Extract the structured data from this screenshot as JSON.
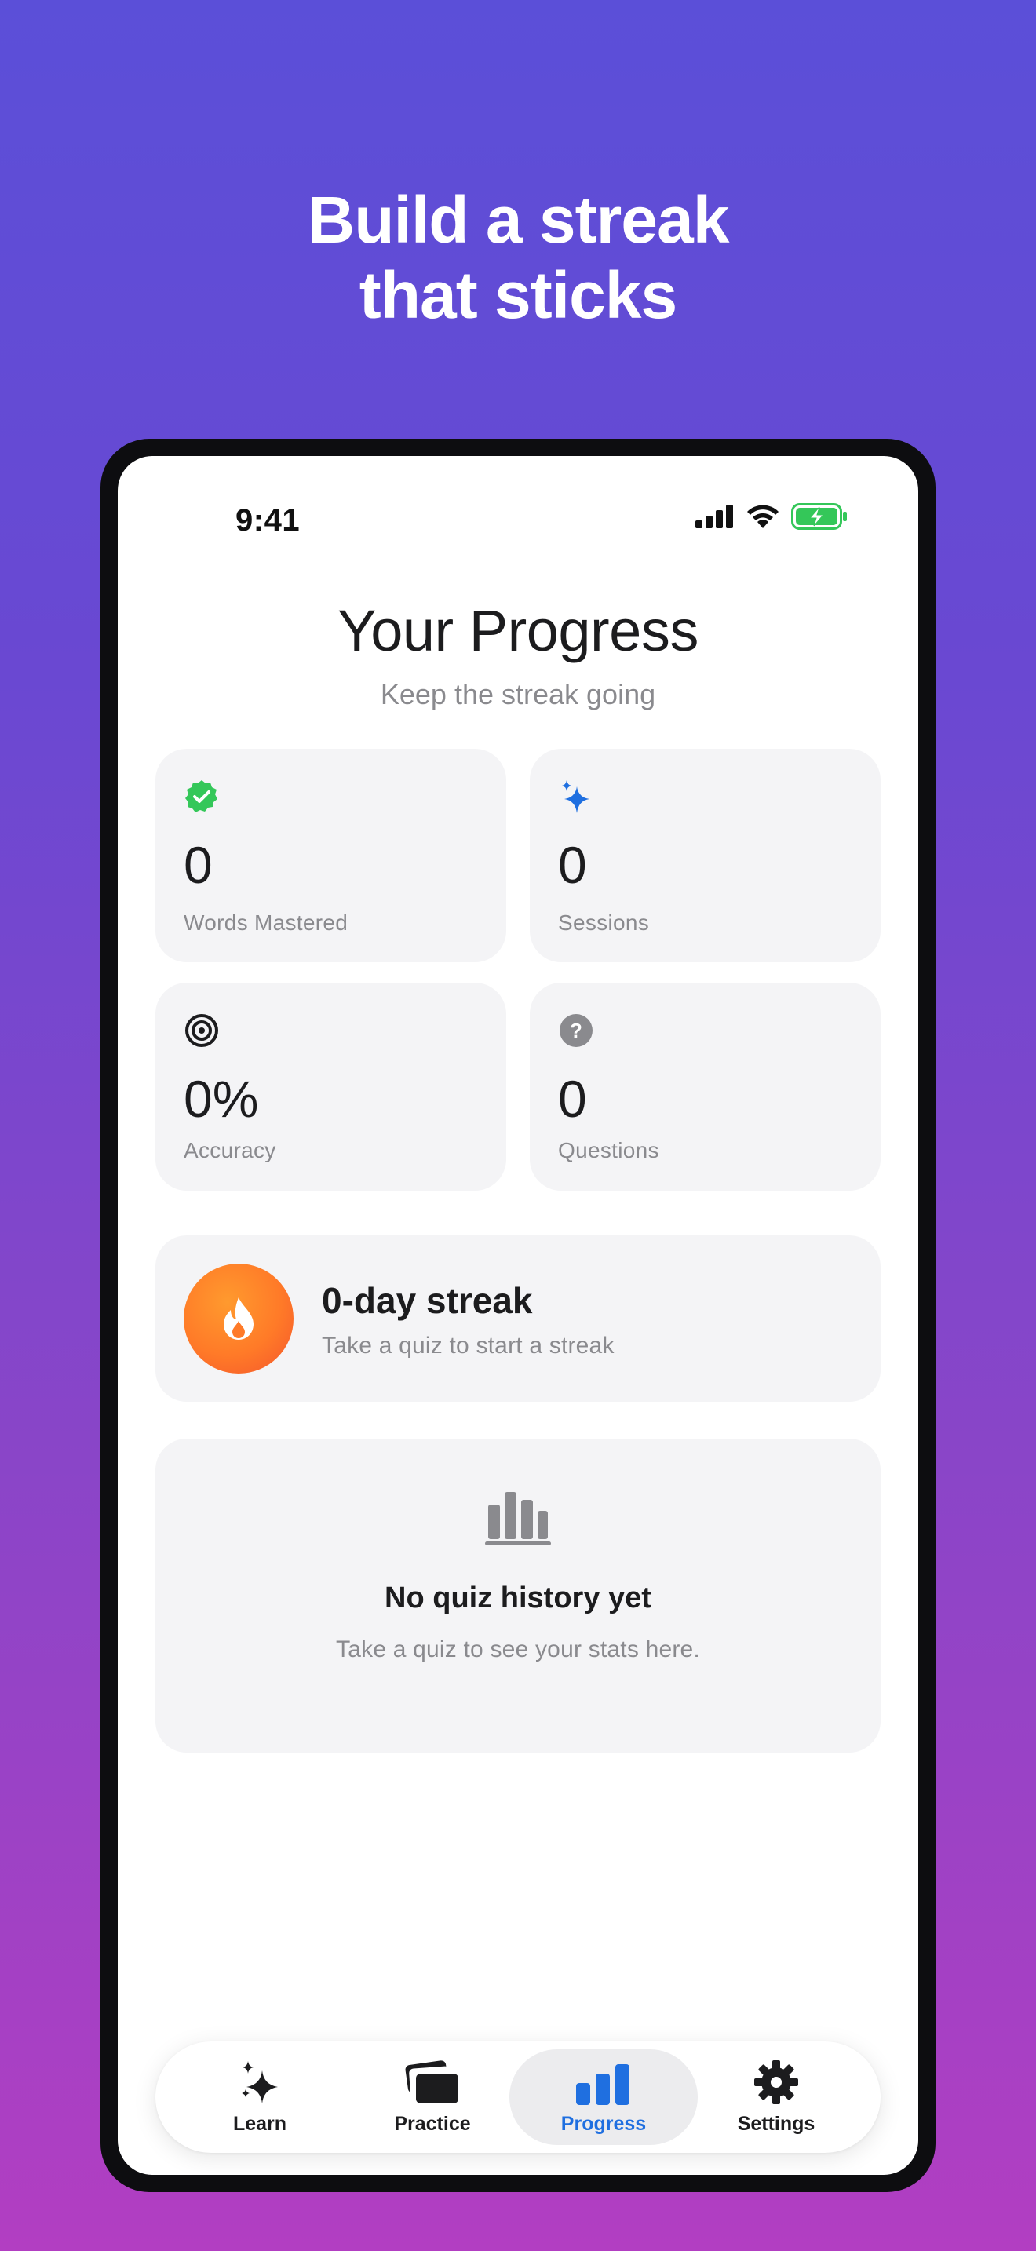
{
  "headline": {
    "line1": "Build a streak",
    "line2": "that sticks"
  },
  "status_bar": {
    "time": "9:41",
    "icons": [
      "cellular-signal-icon",
      "wifi-icon",
      "battery-charging-icon"
    ]
  },
  "header": {
    "title": "Your Progress",
    "subtitle": "Keep the streak going"
  },
  "stats": [
    {
      "icon": "verified-check-icon",
      "value": "0",
      "label": "Words Mastered",
      "color": "#34c759"
    },
    {
      "icon": "sparkles-icon",
      "value": "0",
      "label": "Sessions",
      "color": "#1f6fe0"
    },
    {
      "icon": "target-icon",
      "value": "0%",
      "label": "Accuracy",
      "color": "#1c1c1e"
    },
    {
      "icon": "question-circle-icon",
      "value": "0",
      "label": "Questions",
      "color": "#8a8a8e"
    }
  ],
  "streak": {
    "icon": "flame-icon",
    "title": "0-day streak",
    "subtitle": "Take a quiz to start a streak"
  },
  "empty_state": {
    "icon": "bar-chart-icon",
    "title": "No quiz history yet",
    "subtitle": "Take a quiz to see your stats here."
  },
  "tabs": [
    {
      "icon": "sparkles-icon",
      "label": "Learn",
      "active": false
    },
    {
      "icon": "cards-icon",
      "label": "Practice",
      "active": false
    },
    {
      "icon": "bar-chart-icon",
      "label": "Progress",
      "active": true
    },
    {
      "icon": "gear-icon",
      "label": "Settings",
      "active": false
    }
  ],
  "colors": {
    "accent": "#1f6fe0",
    "streak": "#ff7a28",
    "success": "#34c759"
  }
}
